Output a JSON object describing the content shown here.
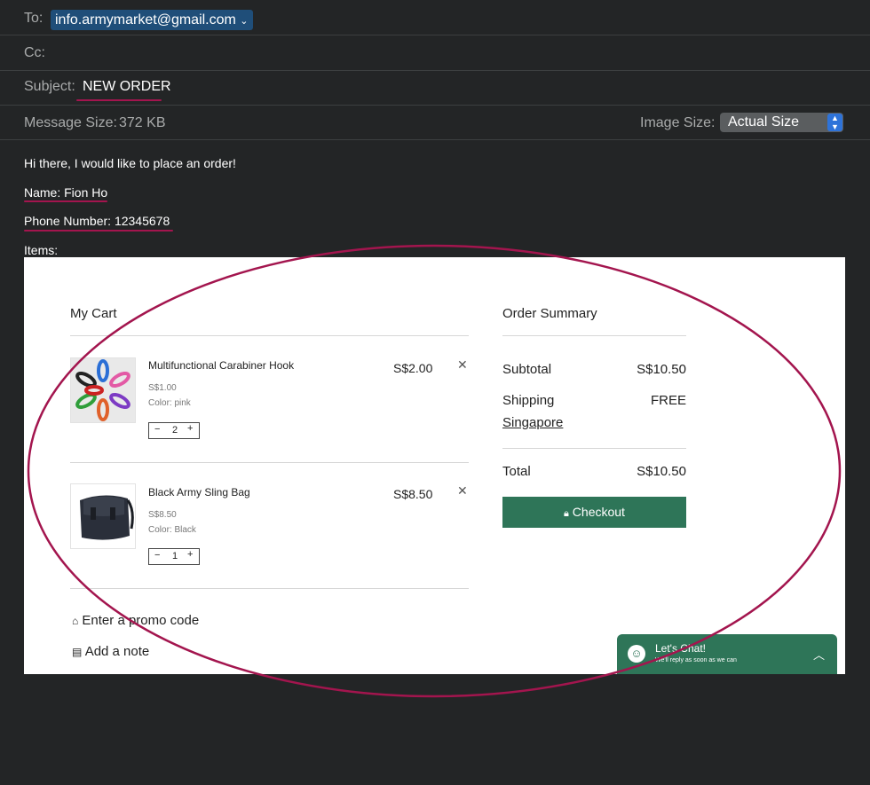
{
  "mail_header": {
    "to_label": "To:",
    "to_value": "info.armymarket@gmail.com",
    "to_chevron": "⌄",
    "cc_label": "Cc:",
    "subject_label": "Subject:",
    "subject_value": "NEW ORDER",
    "message_size_label": "Message Size:",
    "message_size_value": "372 KB",
    "image_size_label": "Image Size:",
    "image_size_value": "Actual Size"
  },
  "message": {
    "greeting": "Hi there, I would like to place an order!",
    "name": "Name: Fion Ho",
    "phone": "Phone Number: 12345678",
    "items_label": "Items:"
  },
  "cart": {
    "title": "My Cart",
    "items": [
      {
        "name": "Multifunctional Carabiner Hook",
        "unit_price": "S$1.00",
        "color": "Color: pink",
        "quantity": "2",
        "total": "S$2.00"
      },
      {
        "name": "Black Army Sling Bag",
        "unit_price": "S$8.50",
        "color": "Color: Black",
        "quantity": "1",
        "total": "S$8.50"
      }
    ],
    "promo": "Enter a promo code",
    "note": "Add a note"
  },
  "summary": {
    "title": "Order Summary",
    "subtotal_label": "Subtotal",
    "subtotal_value": "S$10.50",
    "shipping_label": "Shipping",
    "shipping_value": "FREE",
    "shipping_region": "Singapore",
    "total_label": "Total",
    "total_value": "S$10.50",
    "checkout_label": "Checkout"
  },
  "chat": {
    "title": "Let's Chat!",
    "subtitle": "We'll reply as soon as we can"
  },
  "colors": {
    "background": "#232526",
    "annotation": "#a3154e",
    "checkout": "#2e7558",
    "to_chip": "#1f4e79"
  }
}
